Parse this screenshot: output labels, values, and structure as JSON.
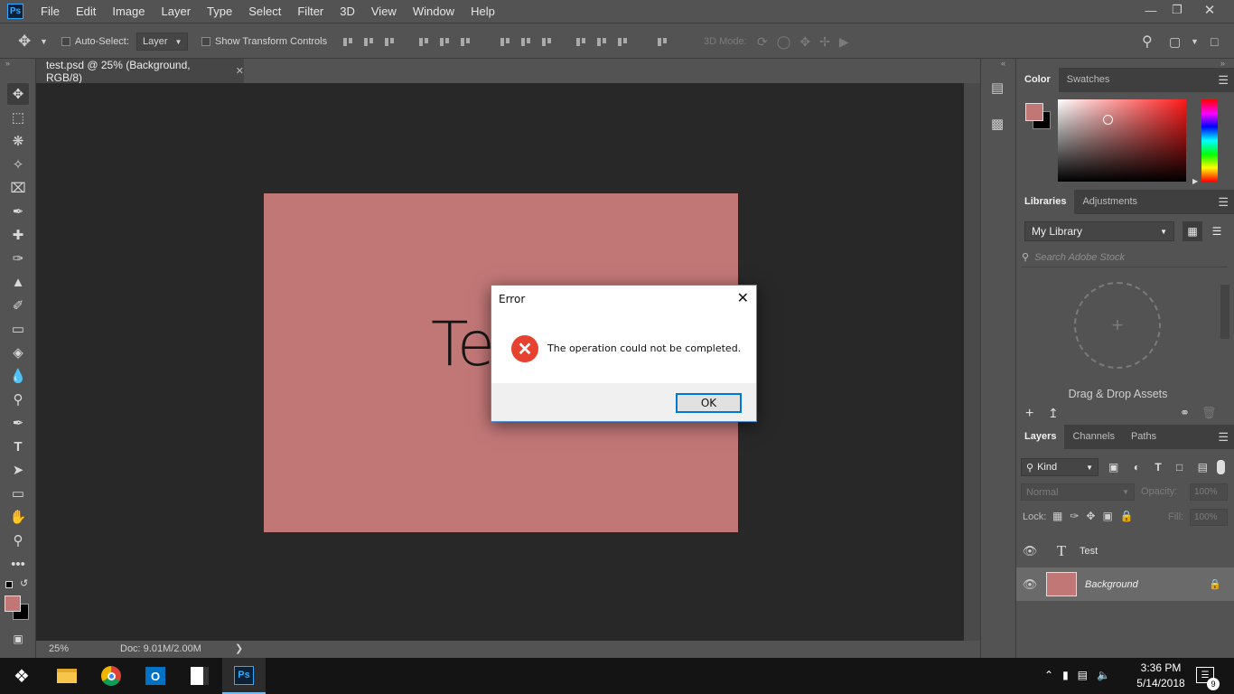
{
  "app": {
    "logo": "Ps"
  },
  "menu": [
    "File",
    "Edit",
    "Image",
    "Layer",
    "Type",
    "Select",
    "Filter",
    "3D",
    "View",
    "Window",
    "Help"
  ],
  "options": {
    "auto_select_label": "Auto-Select:",
    "layer_dropdown": "Layer",
    "show_transform_label": "Show Transform Controls",
    "mode_3d_label": "3D Mode:"
  },
  "document": {
    "tab_title": "test.psd @ 25% (Background, RGB/8)",
    "canvas_text": "Te",
    "bg_color": "#c27777"
  },
  "status": {
    "zoom": "25%",
    "doc_size": "Doc: 9.01M/2.00M"
  },
  "panels": {
    "color_tabs": [
      "Color",
      "Swatches"
    ],
    "library_tabs": [
      "Libraries",
      "Adjustments"
    ],
    "library_select": "My Library",
    "search_placeholder": "Search Adobe Stock",
    "drag_drop": "Drag & Drop Assets",
    "layer_tabs": [
      "Layers",
      "Channels",
      "Paths"
    ],
    "kind_filter": "Kind",
    "blend_mode": "Normal",
    "opacity_label": "Opacity:",
    "opacity_value": "100%",
    "lock_label": "Lock:",
    "fill_label": "Fill:",
    "fill_value": "100%",
    "layers": [
      {
        "name": "Test",
        "type": "text"
      },
      {
        "name": "Background",
        "type": "image",
        "locked": true
      }
    ]
  },
  "dialog": {
    "title": "Error",
    "message": "The operation could not be completed.",
    "ok_label": "OK"
  },
  "taskbar": {
    "time": "3:36 PM",
    "date": "5/14/2018",
    "notification_count": "9"
  },
  "colors": {
    "foreground": "#c27777",
    "background": "#000000",
    "accent": "#31a8ff"
  }
}
